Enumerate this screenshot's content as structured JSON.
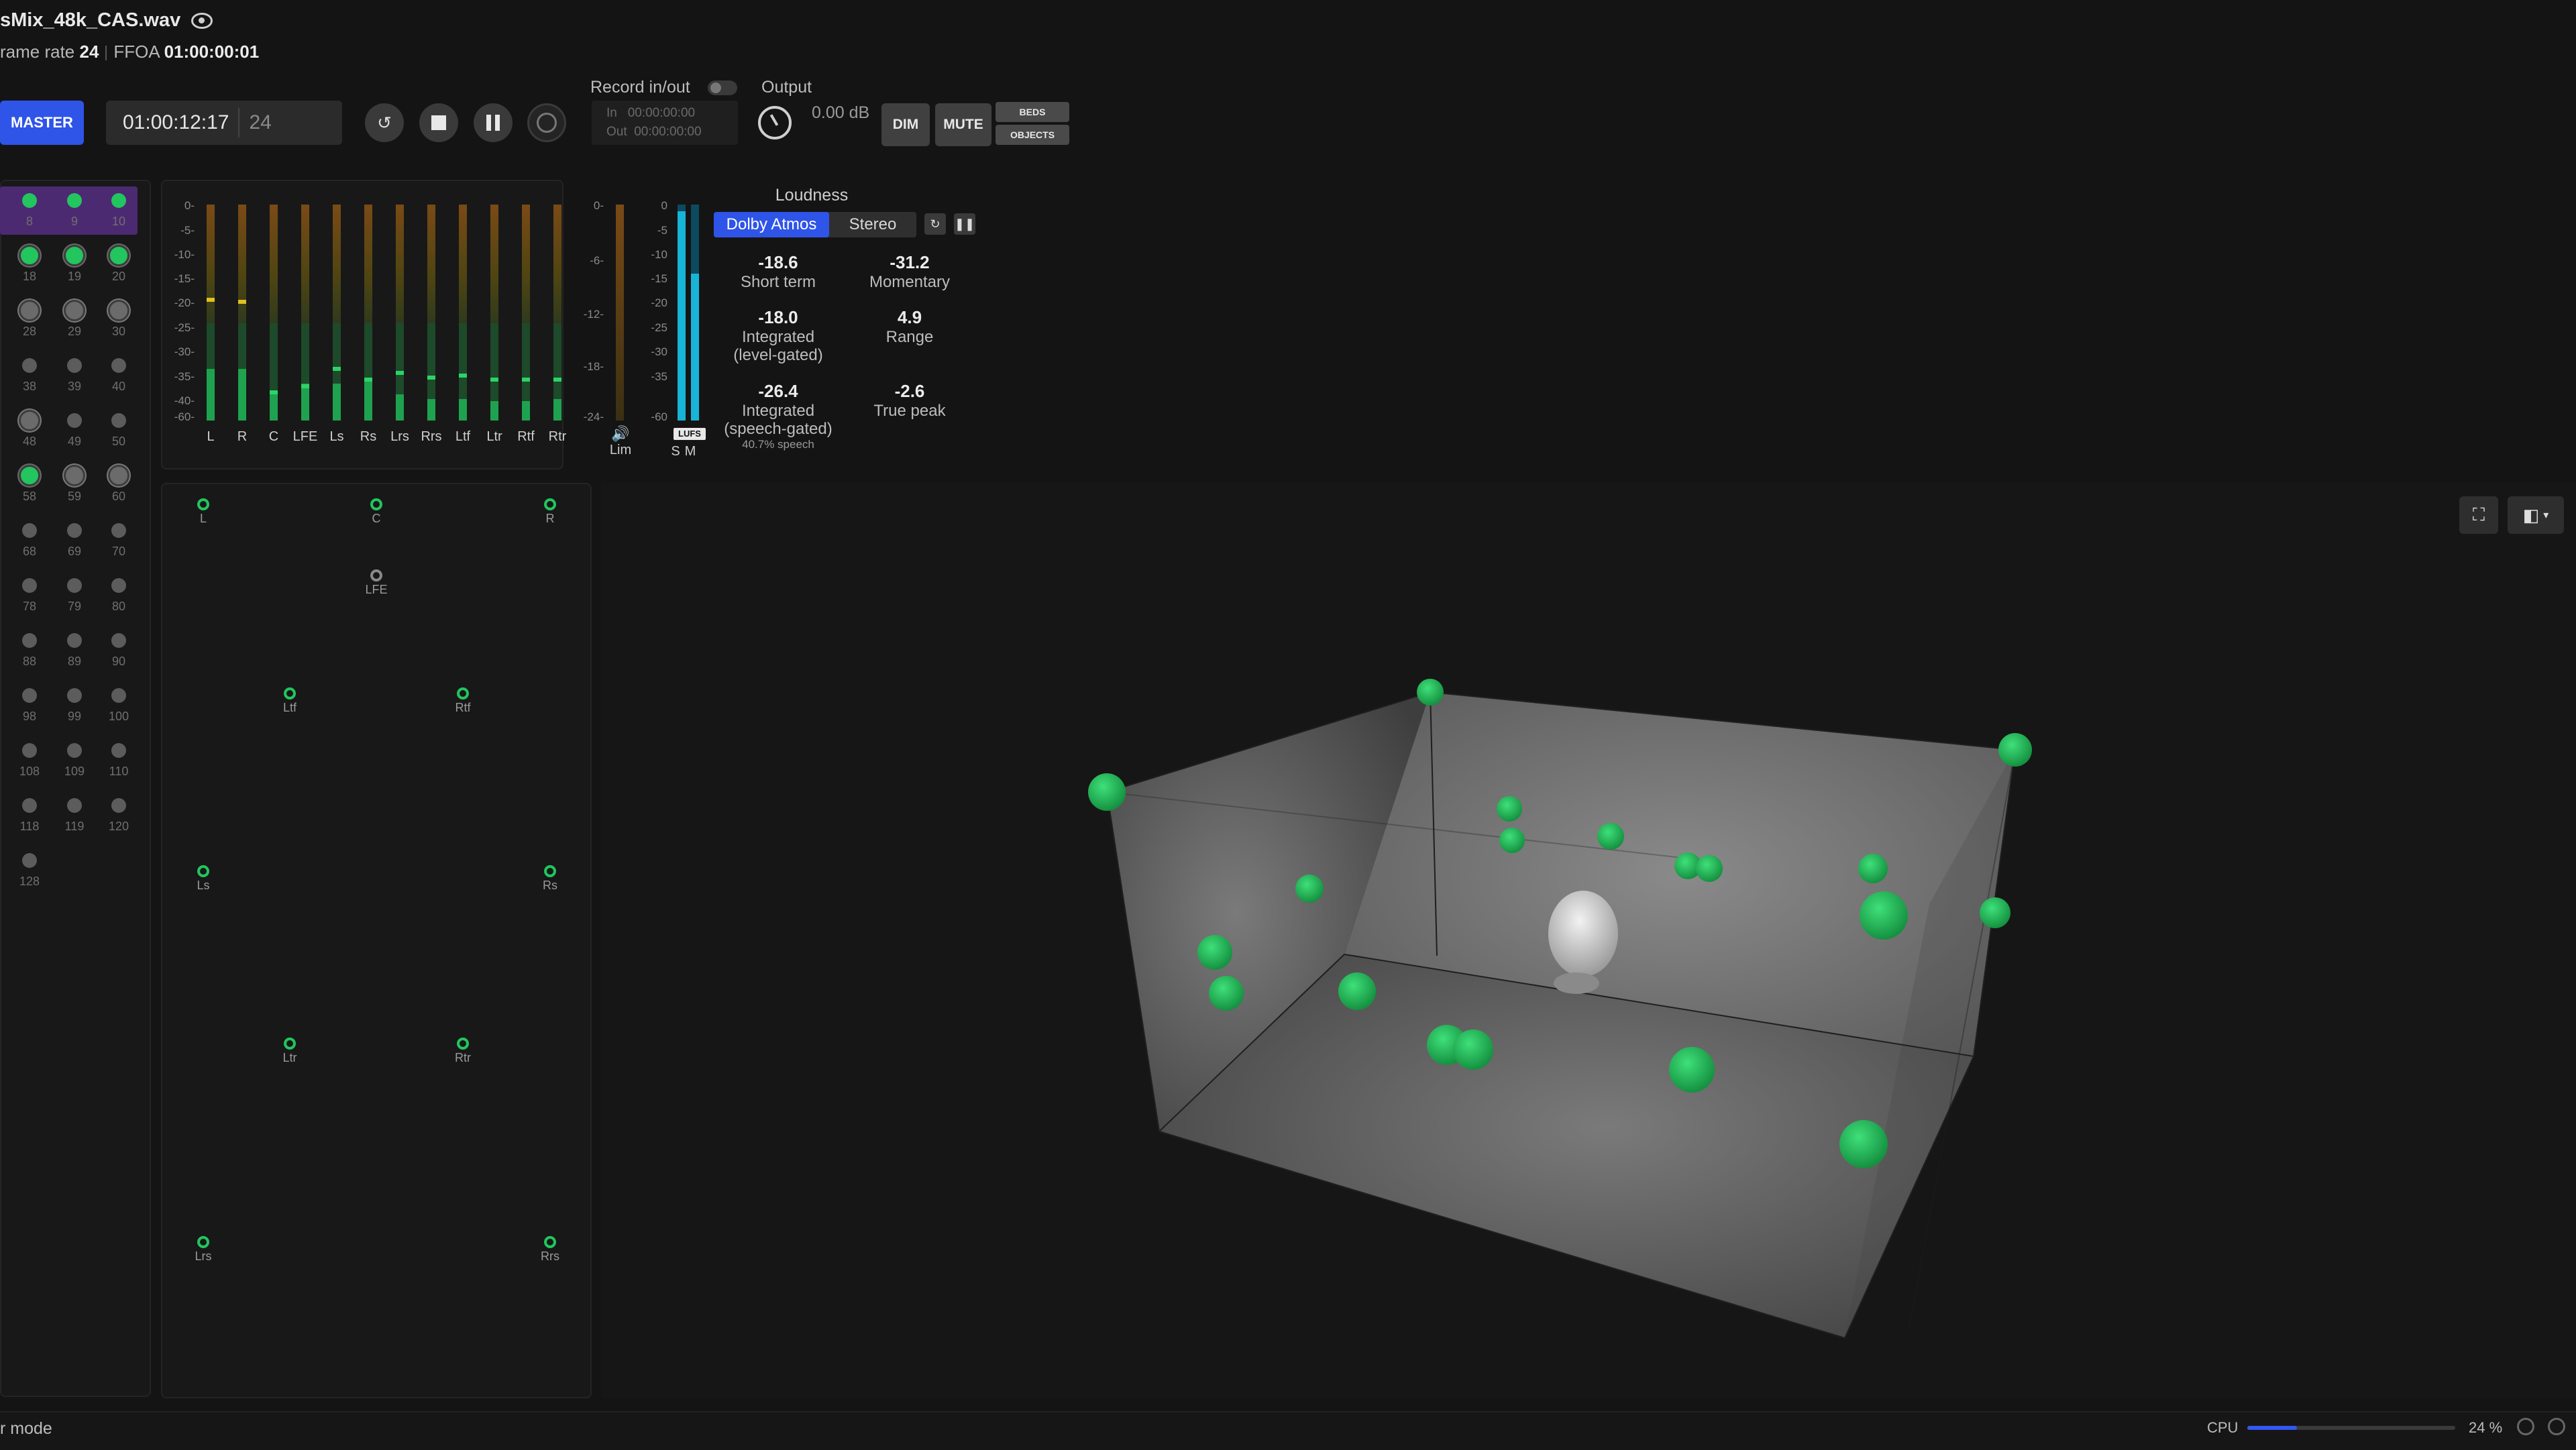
{
  "header": {
    "filename": "sMix_48k_CAS.wav",
    "frame_rate_label": "rame rate",
    "frame_rate_value": "24",
    "ffoa_label": "FFOA",
    "ffoa_value": "01:00:00:01"
  },
  "transport": {
    "master_label": "MASTER",
    "timecode": "01:00:12:17",
    "fps": "24"
  },
  "record": {
    "label": "Record in/out",
    "in_label": "In",
    "in_value": "00:00:00:00",
    "out_label": "Out",
    "out_value": "00:00:00:00"
  },
  "output": {
    "label": "Output",
    "value": "0.00",
    "unit": "dB",
    "dim_label": "DIM",
    "mute_label": "MUTE",
    "beds_label": "BEDS",
    "objects_label": "OBJECTS"
  },
  "channel_grid": {
    "rows": [
      [
        "8",
        "9",
        "10"
      ],
      [
        "18",
        "19",
        "20"
      ],
      [
        "28",
        "29",
        "30"
      ],
      [
        "38",
        "39",
        "40"
      ],
      [
        "48",
        "49",
        "50"
      ],
      [
        "58",
        "59",
        "60"
      ],
      [
        "68",
        "69",
        "70"
      ],
      [
        "78",
        "79",
        "80"
      ],
      [
        "88",
        "89",
        "90"
      ],
      [
        "98",
        "99",
        "100"
      ],
      [
        "108",
        "109",
        "110"
      ],
      [
        "118",
        "119",
        "120"
      ],
      [
        "128"
      ]
    ]
  },
  "meters": {
    "scale": [
      "0-",
      "-5-",
      "-10-",
      "-15-",
      "-20-",
      "-25-",
      "-30-",
      "-35-",
      "-40-",
      "-60-"
    ],
    "channels": [
      {
        "label": "L",
        "level": 0.24,
        "peak": 0.55
      },
      {
        "label": "R",
        "level": 0.24,
        "peak": 0.54
      },
      {
        "label": "C",
        "level": 0.12,
        "peak": 0.12
      },
      {
        "label": "LFE",
        "level": 0.17,
        "peak": 0.15
      },
      {
        "label": "Ls",
        "level": 0.17,
        "peak": 0.23
      },
      {
        "label": "Rs",
        "level": 0.19,
        "peak": 0.18
      },
      {
        "label": "Lrs",
        "level": 0.12,
        "peak": 0.21
      },
      {
        "label": "Rrs",
        "level": 0.1,
        "peak": 0.19
      },
      {
        "label": "Ltf",
        "level": 0.1,
        "peak": 0.2
      },
      {
        "label": "Ltr",
        "level": 0.09,
        "peak": 0.18
      },
      {
        "label": "Rtf",
        "level": 0.09,
        "peak": 0.18
      },
      {
        "label": "Rtr",
        "level": 0.1,
        "peak": 0.18
      }
    ],
    "lim_scale": [
      "0-",
      "-6-",
      "-12-",
      "-18-",
      "-24-"
    ],
    "lim_label": "Lim",
    "lufs_scale": [
      "0",
      "-5",
      "-10",
      "-15",
      "-20",
      "-25",
      "-30",
      "-35",
      "-60"
    ],
    "lufs_badge": "LUFS",
    "s_label": "S",
    "m_label": "M",
    "lufs_s_level": 0.97,
    "lufs_m_level": 0.68
  },
  "loudness": {
    "title": "Loudness",
    "tab_atmos": "Dolby Atmos",
    "tab_stereo": "Stereo",
    "short_term": {
      "value": "-18.6",
      "label": "Short term"
    },
    "momentary": {
      "value": "-31.2",
      "label": "Momentary"
    },
    "integrated_level": {
      "value": "-18.0",
      "label1": "Integrated",
      "label2": "(level-gated)"
    },
    "range": {
      "value": "4.9",
      "label": "Range"
    },
    "integrated_speech": {
      "value": "-26.4",
      "label1": "Integrated",
      "label2": "(speech-gated)",
      "note": "40.7% speech"
    },
    "true_peak": {
      "value": "-2.6",
      "label": "True peak"
    }
  },
  "speakers": {
    "labels": [
      "L",
      "C",
      "R",
      "LFE",
      "Ltf",
      "Rtf",
      "Ls",
      "Rs",
      "Ltr",
      "Rtr",
      "Lrs",
      "Rrs"
    ]
  },
  "colors": {
    "accent": "#2f54e8",
    "active_green": "#22c55e",
    "selection_purple": "#4c2a72"
  },
  "footer": {
    "mode_text": "r mode",
    "cpu_label": "CPU",
    "cpu_value": "24 %",
    "cpu_fraction": 0.24
  }
}
